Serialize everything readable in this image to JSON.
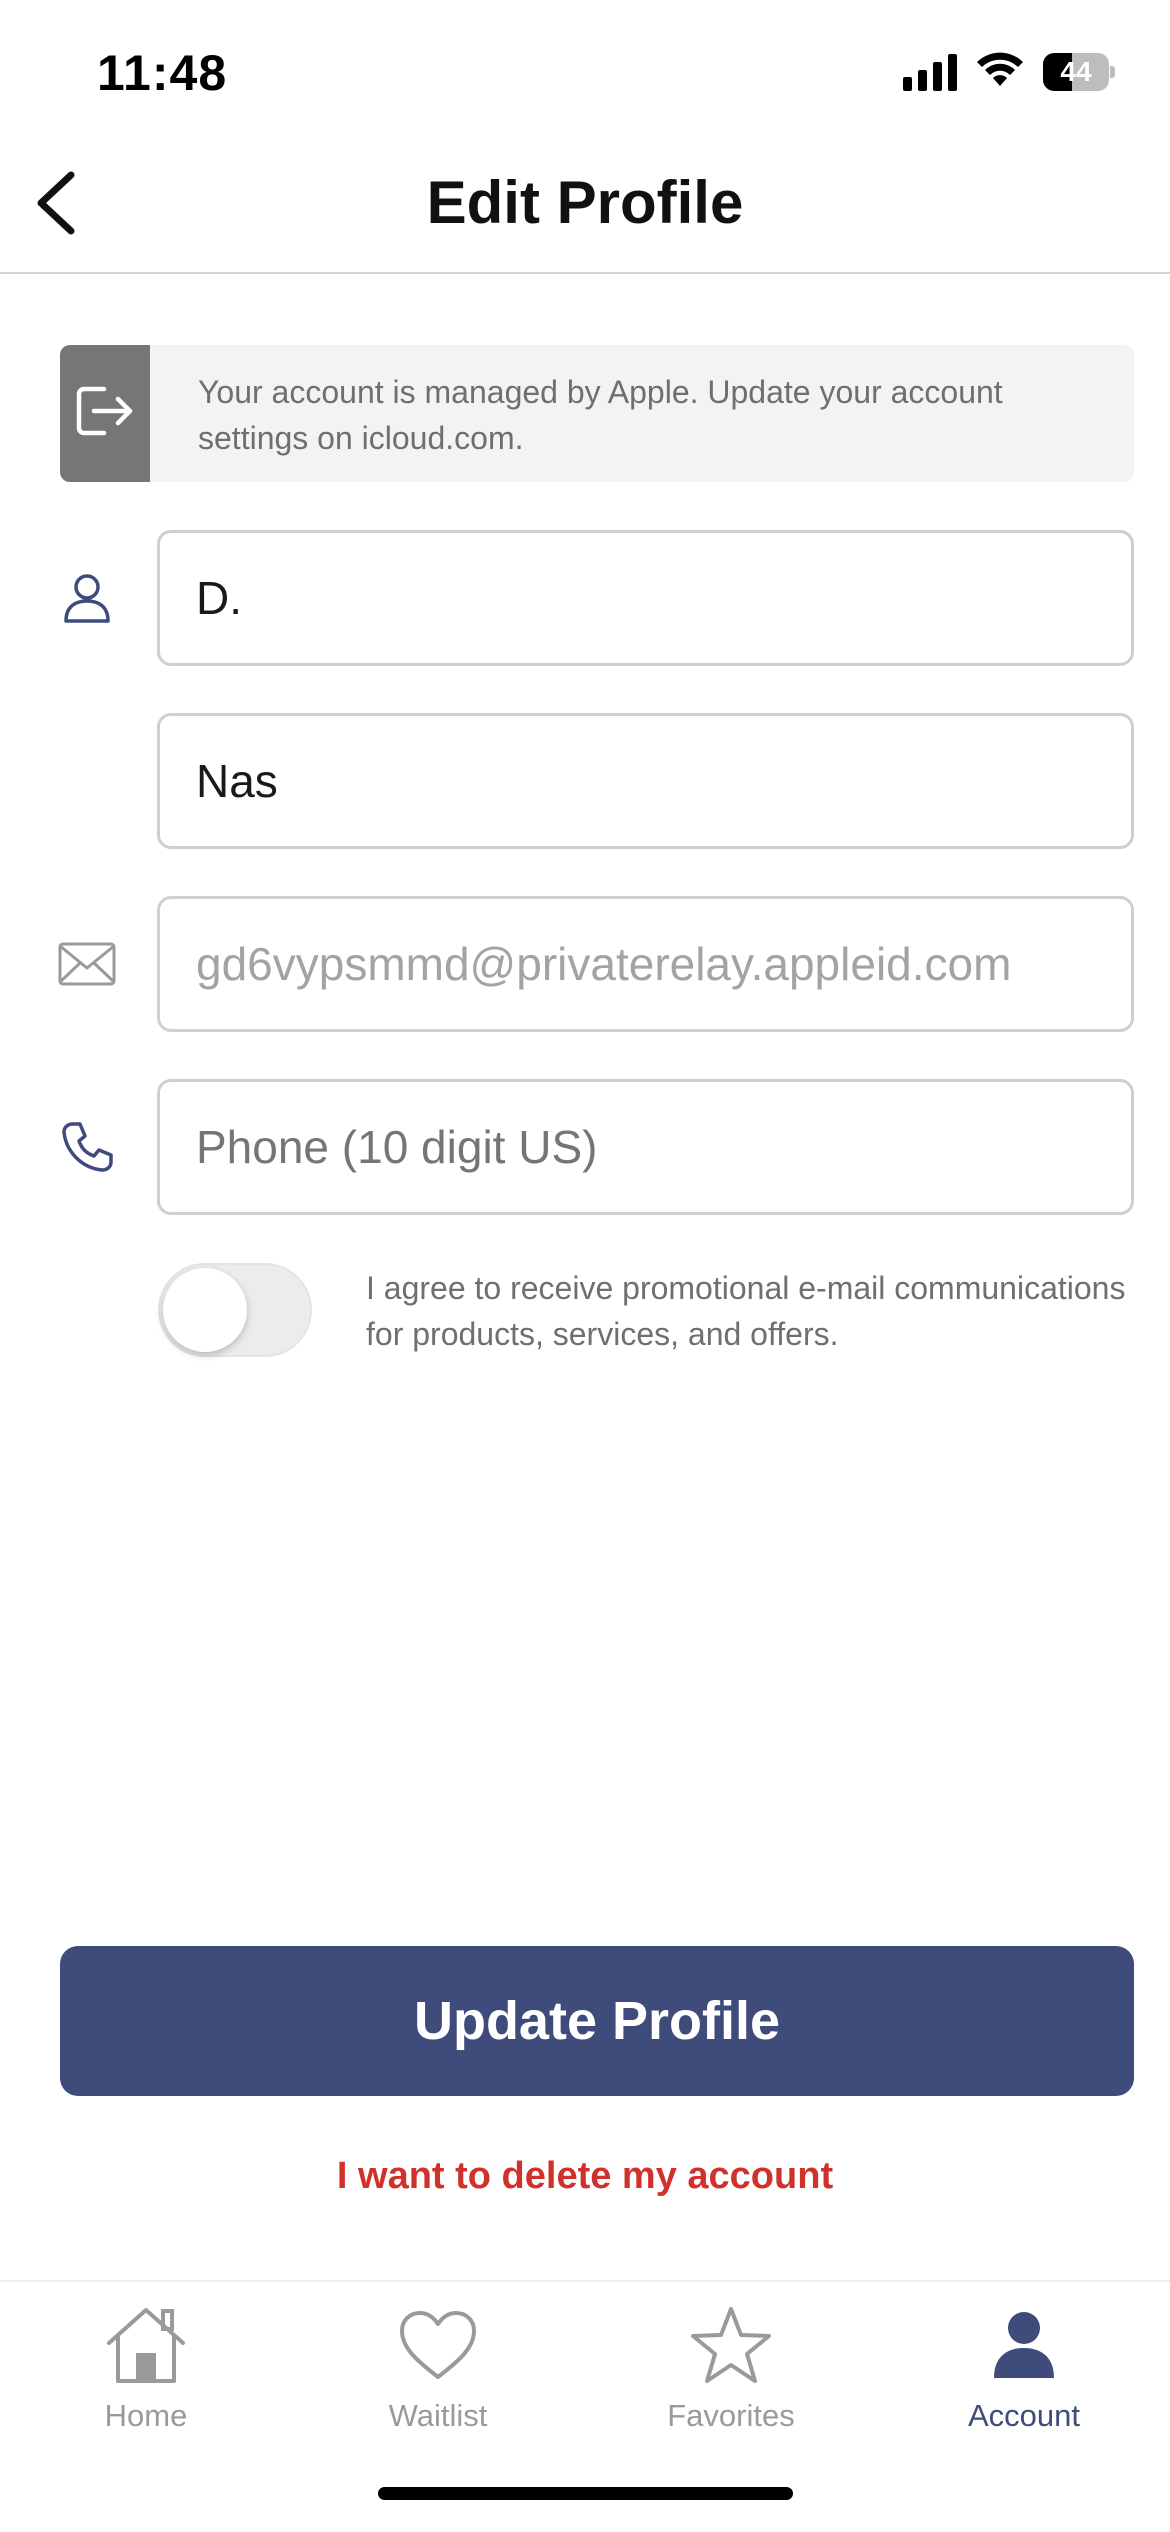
{
  "status_bar": {
    "time": "11:48",
    "battery": "44",
    "battery_level": 0.44,
    "icons": [
      "signal-icon",
      "wifi-icon",
      "battery-icon"
    ]
  },
  "nav": {
    "back_icon": "chevron-left-icon",
    "title": "Edit Profile"
  },
  "banner": {
    "icon": "sign-out-icon",
    "text": "Your account is managed by Apple. Update your account settings on icloud.com."
  },
  "form": {
    "first_name": {
      "icon": "person-icon",
      "value": "D."
    },
    "last_name": {
      "value": "Nas"
    },
    "email": {
      "icon": "envelope-icon",
      "value": "gd6vypsmmd@privaterelay.appleid.com"
    },
    "phone": {
      "icon": "phone-icon",
      "placeholder": "Phone (10 digit US)"
    },
    "promo_toggle": {
      "on": false,
      "label": "I agree to receive promotional e-mail communications for products, services, and offers."
    }
  },
  "actions": {
    "update_label": "Update Profile",
    "delete_label": "I want to delete my account"
  },
  "tab_bar": {
    "items": [
      {
        "label": "Home",
        "icon": "home-icon",
        "active": false
      },
      {
        "label": "Waitlist",
        "icon": "heart-icon",
        "active": false
      },
      {
        "label": "Favorites",
        "icon": "star-icon",
        "active": false
      },
      {
        "label": "Account",
        "icon": "account-icon",
        "active": true
      }
    ]
  },
  "colors": {
    "brand": "#3f4b7b",
    "danger": "#d0322b",
    "muted_text": "#6f6f6f",
    "field_border": "#cfcfcf"
  }
}
